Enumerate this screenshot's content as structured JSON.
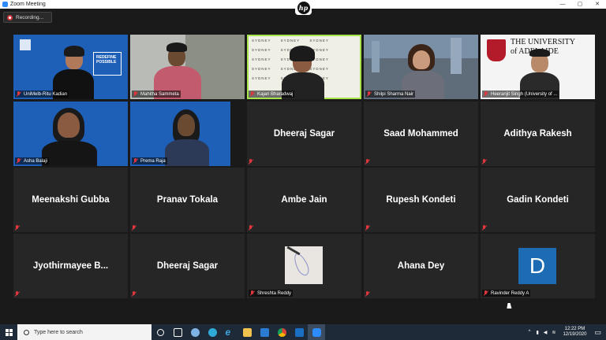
{
  "window": {
    "title": "Zoom Meeting",
    "controls": [
      "—",
      "▢",
      "✕"
    ]
  },
  "recording": {
    "label": "Recording..."
  },
  "hp_logo": "hp",
  "tiles": [
    {
      "label": "UniMelb-Ritu Kadian",
      "display": ""
    },
    {
      "label": "Mahitha Sammeta",
      "display": ""
    },
    {
      "label": "Kajari Bharadwaj",
      "display": ""
    },
    {
      "label": "Shilpi Sharma Nair",
      "display": ""
    },
    {
      "label": "Heeranjit Singh (University of ...",
      "display": ""
    },
    {
      "label": "Asha Balaji",
      "display": ""
    },
    {
      "label": "Prema Raja",
      "display": ""
    },
    {
      "label": "",
      "display": "Dheeraj Sagar"
    },
    {
      "label": "",
      "display": "Saad Mohammed"
    },
    {
      "label": "",
      "display": "Adithya Rakesh"
    },
    {
      "label": "",
      "display": "Meenakshi Gubba"
    },
    {
      "label": "",
      "display": "Pranav Tokala"
    },
    {
      "label": "",
      "display": "Ambe Jain"
    },
    {
      "label": "",
      "display": "Rupesh Kondeti"
    },
    {
      "label": "",
      "display": "Gadin Kondeti"
    },
    {
      "label": "",
      "display": "Jyothirmayee  B..."
    },
    {
      "label": "",
      "display": "Dheeraj Sagar"
    },
    {
      "label": "Shreshta Reddy",
      "display": ""
    },
    {
      "label": "",
      "display": "Ahana Dey"
    },
    {
      "label": "Ravinder Reddy A",
      "display": "D"
    }
  ],
  "tile_texts": {
    "redefine": "REDEFINE\nPOSSIBLE",
    "sydney": "SYDNEY",
    "adelaide": "THE UNIVERSITY\nof ADELAIDE"
  },
  "taskbar": {
    "search_placeholder": "Type here to search",
    "time": "12:22 PM",
    "date": "12/19/2020"
  },
  "colors": {
    "active_speaker": "#a9e34b",
    "muted_icon": "#e0363d",
    "zoom_blue": "#2d8cff"
  }
}
